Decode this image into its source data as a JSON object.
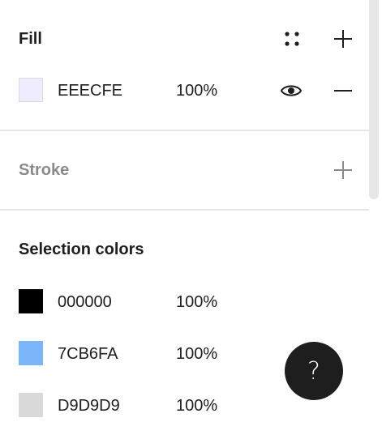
{
  "fill": {
    "title": "Fill",
    "styles_icon": "four-dots-styles-icon",
    "add_icon": "plus-icon",
    "item": {
      "color": "#EEECFE",
      "hex": "EEECFE",
      "opacity": "100%",
      "visibility_icon": "eye-icon",
      "remove_icon": "minus-icon"
    }
  },
  "stroke": {
    "title": "Stroke",
    "add_icon": "plus-icon"
  },
  "selection_colors": {
    "title": "Selection colors",
    "items": [
      {
        "color": "#000000",
        "hex": "000000",
        "opacity": "100%"
      },
      {
        "color": "#7CB6FA",
        "hex": "7CB6FA",
        "opacity": "100%"
      },
      {
        "color": "#D9D9D9",
        "hex": "D9D9D9",
        "opacity": "100%"
      }
    ]
  },
  "help": {
    "label": "?",
    "icon": "question-mark-icon"
  }
}
